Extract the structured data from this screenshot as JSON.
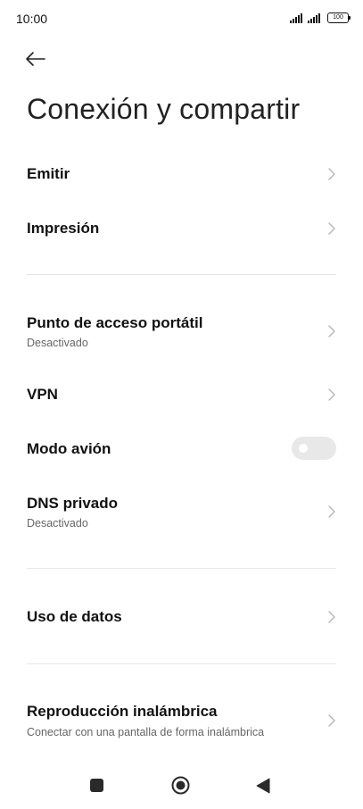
{
  "status_bar": {
    "time": "10:00",
    "battery": "100",
    "icons": [
      "signal-icon",
      "signal-icon",
      "battery-icon"
    ]
  },
  "header": {
    "back_icon": "back-arrow-icon",
    "title": "Conexión y compartir"
  },
  "settings": {
    "emitir": {
      "title": "Emitir"
    },
    "impresion": {
      "title": "Impresión"
    },
    "hotspot": {
      "title": "Punto de acceso portátil",
      "subtitle": "Desactivado"
    },
    "vpn": {
      "title": "VPN"
    },
    "airplane": {
      "title": "Modo avión",
      "enabled": false
    },
    "private_dns": {
      "title": "DNS privado",
      "subtitle": "Desactivado"
    },
    "data_usage": {
      "title": "Uso de datos"
    },
    "wireless_display": {
      "title": "Reproducción inalámbrica",
      "subtitle": "Conectar con una pantalla de forma inalámbrica"
    }
  },
  "nav_bar": {
    "icons": [
      "recents-icon",
      "home-icon",
      "back-icon"
    ]
  },
  "colors": {
    "background": "#ffffff",
    "text": "#111111",
    "subtext": "#666666",
    "divider": "#e6e6e6",
    "chevron": "#b5b5b5",
    "toggle_off": "#e8e8e8"
  }
}
